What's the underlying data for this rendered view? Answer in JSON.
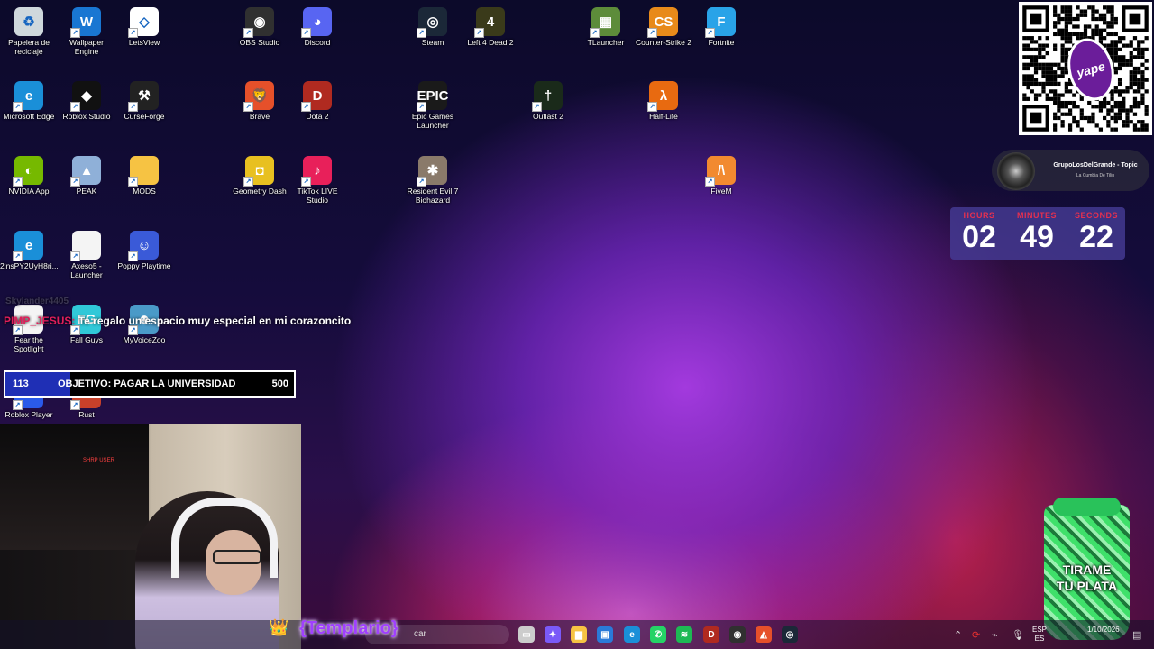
{
  "desktop": {
    "icons": [
      {
        "label": "Papelera de reciclaje",
        "icon": "recycle-bin-icon",
        "color": "#cfd8dc",
        "glyph": "♻"
      },
      {
        "label": "Wallpaper Engine",
        "icon": "wallpaper-engine-icon",
        "color": "#1976d2",
        "glyph": "W"
      },
      {
        "label": "LetsView",
        "icon": "letsview-icon",
        "color": "#ffffff",
        "glyph": "◇"
      },
      {
        "label": "OBS Studio",
        "icon": "obs-icon",
        "color": "#303030",
        "glyph": "◉"
      },
      {
        "label": "Discord",
        "icon": "discord-icon",
        "color": "#5865f2",
        "glyph": "◕"
      },
      {
        "label": "Steam",
        "icon": "steam-icon",
        "color": "#1b2838",
        "glyph": "◎"
      },
      {
        "label": "Left 4 Dead 2",
        "icon": "left4dead2-icon",
        "color": "#3a3a1a",
        "glyph": "4"
      },
      {
        "label": "TLauncher",
        "icon": "tlauncher-icon",
        "color": "#5d8c3a",
        "glyph": "▦"
      },
      {
        "label": "Counter-Strike 2",
        "icon": "cs2-icon",
        "color": "#e88a1a",
        "glyph": "CS"
      },
      {
        "label": "Fortnite",
        "icon": "fortnite-icon",
        "color": "#29a3e8",
        "glyph": "F"
      },
      {
        "label": "Microsoft Edge",
        "icon": "edge-icon",
        "color": "#1a8fd8",
        "glyph": "e"
      },
      {
        "label": "Roblox Studio",
        "icon": "roblox-studio-icon",
        "color": "#111111",
        "glyph": "◆"
      },
      {
        "label": "CurseForge",
        "icon": "curseforge-icon",
        "color": "#222222",
        "glyph": "⚒"
      },
      {
        "label": "Brave",
        "icon": "brave-icon",
        "color": "#e6502a",
        "glyph": "🦁"
      },
      {
        "label": "Dota 2",
        "icon": "dota2-icon",
        "color": "#b02a20",
        "glyph": "D"
      },
      {
        "label": "Epic Games Launcher",
        "icon": "epic-games-icon",
        "color": "#1a1a1a",
        "glyph": "EPIC"
      },
      {
        "label": "Outlast 2",
        "icon": "outlast2-icon",
        "color": "#1a2a1a",
        "glyph": "†"
      },
      {
        "label": "Half-Life",
        "icon": "half-life-icon",
        "color": "#e86a10",
        "glyph": "λ"
      },
      {
        "label": "NVIDIA App",
        "icon": "nvidia-icon",
        "color": "#76b900",
        "glyph": "◐"
      },
      {
        "label": "PEAK",
        "icon": "peak-icon",
        "color": "#8fb0d8",
        "glyph": "▲"
      },
      {
        "label": "MODS",
        "icon": "folder-icon",
        "color": "#f6c343",
        "glyph": ""
      },
      {
        "label": "Geometry Dash",
        "icon": "geometry-dash-icon",
        "color": "#e8c020",
        "glyph": "◘"
      },
      {
        "label": "TikTok LIVE Studio",
        "icon": "tiktok-live-icon",
        "color": "#e8205a",
        "glyph": "♪"
      },
      {
        "label": "Resident Evil 7 Biohazard",
        "icon": "resident-evil-7-icon",
        "color": "#8a7a6a",
        "glyph": "✱"
      },
      {
        "label": "FiveM",
        "icon": "fivem-icon",
        "color": "#f28a30",
        "glyph": "/\\"
      },
      {
        "label": "2insPY2UyH8ri...",
        "icon": "edge-shortcut-icon",
        "color": "#1a8fd8",
        "glyph": "e"
      },
      {
        "label": "Axeso5 - Launcher",
        "icon": "file-icon",
        "color": "#f4f4f4",
        "glyph": ""
      },
      {
        "label": "Poppy Playtime",
        "icon": "poppy-playtime-icon",
        "color": "#3a5ad8",
        "glyph": "☺"
      },
      {
        "label": "Fear the Spotlight",
        "icon": "fear-spotlight-icon",
        "color": "#f4f4f4",
        "glyph": ""
      },
      {
        "label": "Fall Guys",
        "icon": "fall-guys-icon",
        "color": "#30c8d8",
        "glyph": "FG"
      },
      {
        "label": "MyVoiceZoo",
        "icon": "myvoicezoo-icon",
        "color": "#4a9ac8",
        "glyph": "☻"
      },
      {
        "label": "Roblox Player",
        "icon": "roblox-player-icon",
        "color": "#2a5ae8",
        "glyph": "■"
      },
      {
        "label": "Rust",
        "icon": "rust-icon",
        "color": "#c8402a",
        "glyph": "R"
      }
    ]
  },
  "overlay": {
    "chat": {
      "ghost_user": "Skylander4405",
      "username": "PIMP_JESUS:",
      "message": "Te regalo un espacio muy especial en mi corazoncito"
    },
    "goal": {
      "current": "113",
      "label": "OBJETIVO: PAGAR LA UNIVERSIDAD",
      "target": "500",
      "progress": 0.226
    },
    "now_playing": {
      "title": "GrupoLosDelGrande - Topic",
      "subtitle": "La Cumbia De Tilin"
    },
    "timer": {
      "hours_label": "HOURS",
      "minutes_label": "MINUTES",
      "seconds_label": "SECONDS",
      "hours": "02",
      "minutes": "49",
      "seconds": "22"
    },
    "qr_badge": "yape",
    "qr_badge_small": "S/",
    "webcam_sign": "SHRP USER",
    "templario": "{Templario}",
    "tip_cup_line1": "TIRAME",
    "tip_cup_line2": "TU PLATA"
  },
  "taskbar": {
    "search_placeholder": "car",
    "apps": [
      {
        "icon": "task-view-icon",
        "color": "#cccccc",
        "glyph": "▭"
      },
      {
        "icon": "copilot-icon",
        "color": "#7a5af8",
        "glyph": "✦"
      },
      {
        "icon": "file-explorer-icon",
        "color": "#f6c343",
        "glyph": "▆"
      },
      {
        "icon": "microsoft-store-icon",
        "color": "#2a7ad8",
        "glyph": "▣"
      },
      {
        "icon": "edge-icon",
        "color": "#1a8fd8",
        "glyph": "e"
      },
      {
        "icon": "whatsapp-icon",
        "color": "#25d366",
        "glyph": "✆"
      },
      {
        "icon": "spotify-icon",
        "color": "#1db954",
        "glyph": "≋"
      },
      {
        "icon": "dota2-icon",
        "color": "#b02a20",
        "glyph": "D"
      },
      {
        "icon": "obs-icon",
        "color": "#303030",
        "glyph": "◉"
      },
      {
        "icon": "brave-icon",
        "color": "#e6502a",
        "glyph": "◭"
      },
      {
        "icon": "steam-icon",
        "color": "#1b2838",
        "glyph": "◎"
      }
    ],
    "language": "ESP",
    "region": "ES",
    "time": "",
    "date": "1/10/2026"
  }
}
